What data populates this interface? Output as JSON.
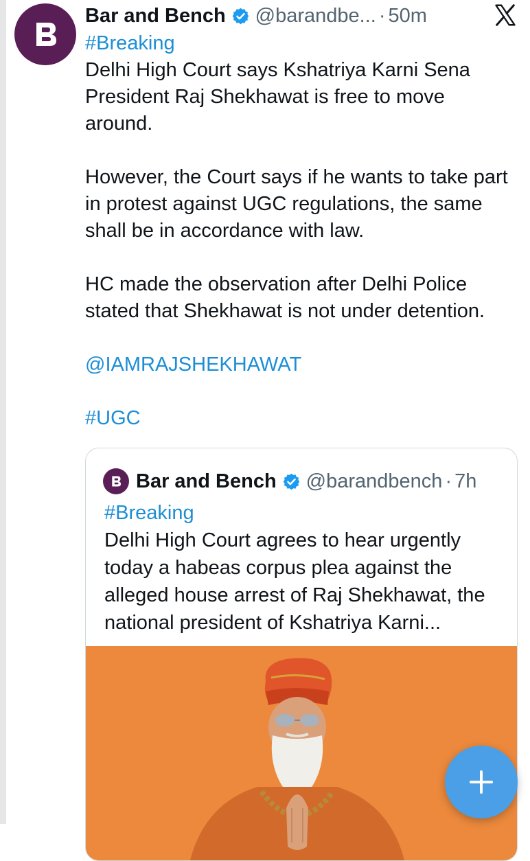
{
  "tweet": {
    "author_name": "Bar and Bench",
    "handle": "@barandbe...",
    "separator": "·",
    "time": "50m",
    "hashtag": "#Breaking",
    "para1": "Delhi High Court says Kshatriya Karni Sena President Raj Shekhawat is free to move around.",
    "para2": "However, the Court says if he wants to take part in protest against UGC regulations, the same shall be in accordance with law.",
    "para3": "HC made the observation after Delhi Police stated that Shekhawat is not under detention.",
    "mention": "@IAMRAJSHEKHAWAT",
    "tag2": "#UGC"
  },
  "quote": {
    "author_name": "Bar and Bench",
    "handle": "@barandbench",
    "separator": "·",
    "time": "7h",
    "hashtag": "#Breaking",
    "text": "Delhi High Court agrees to hear urgently today a habeas corpus plea against the alleged house arrest of Raj Shekhawat, the national president of Kshatriya Karni..."
  },
  "icons": {
    "avatar": "bar-and-bench-logo",
    "verified": "verified-badge-icon",
    "close": "x-logo-icon",
    "compose": "plus-icon"
  },
  "colors": {
    "brand": "#5a1e57",
    "link": "#1d8ed6",
    "verified": "#1d9bf0",
    "fab": "#4a9fe6",
    "image_bg": "#ec893c"
  }
}
